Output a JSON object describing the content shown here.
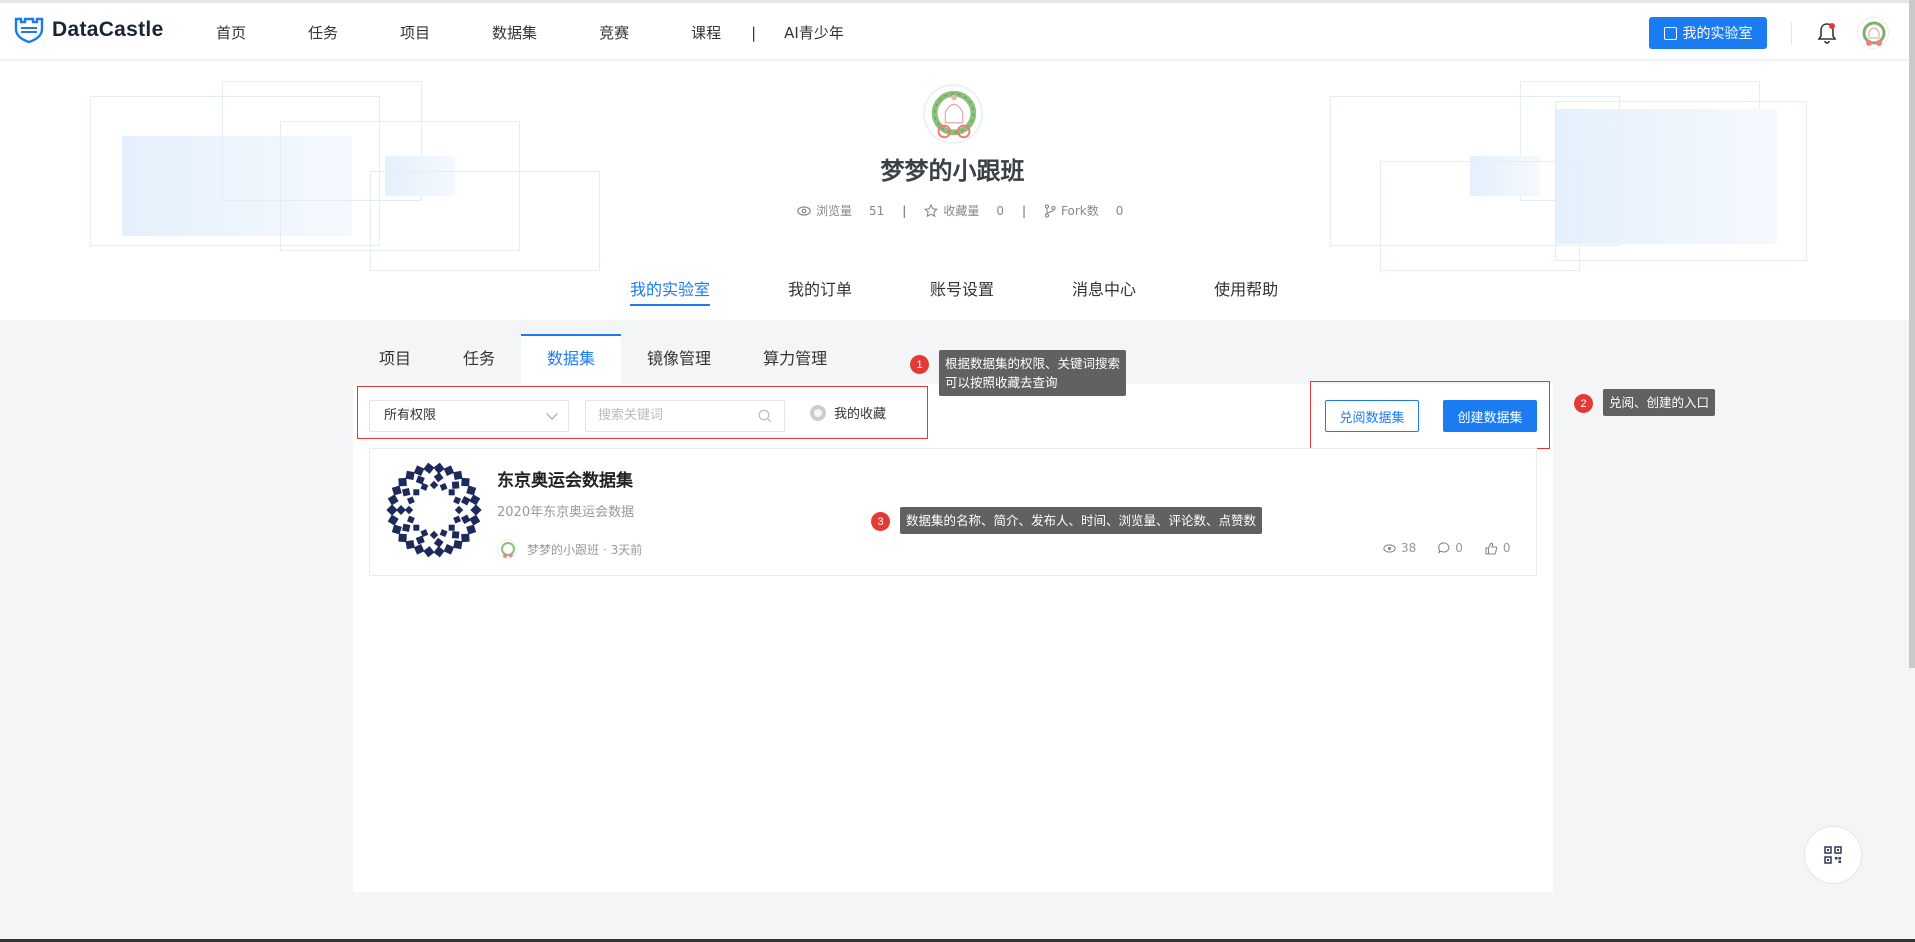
{
  "app": {
    "logo_text": "DataCastle"
  },
  "nav": {
    "items": [
      "首页",
      "任务",
      "项目",
      "数据集",
      "竞赛",
      "课程"
    ],
    "separator": "|",
    "extra": "AI青少年",
    "lab_button": "我的实验室"
  },
  "profile": {
    "name": "梦梦的小跟班",
    "stats": [
      {
        "label": "浏览量",
        "value": "51",
        "icon": "eye-icon"
      },
      {
        "label": "收藏量",
        "value": "0",
        "icon": "star-icon"
      },
      {
        "label": "Fork数",
        "value": "0",
        "icon": "fork-icon"
      }
    ],
    "stat_separator": "|"
  },
  "subnav": {
    "items": [
      "我的实验室",
      "我的订单",
      "账号设置",
      "消息中心",
      "使用帮助"
    ],
    "active": "我的实验室"
  },
  "tabs": {
    "items": [
      "项目",
      "任务",
      "数据集",
      "镜像管理",
      "算力管理"
    ],
    "active": "数据集"
  },
  "filters": {
    "permission_value": "所有权限",
    "search_placeholder": "搜索关键词",
    "favorites_label": "我的收藏"
  },
  "actions": {
    "redeem_label": "兑阅数据集",
    "create_label": "创建数据集"
  },
  "dataset_card": {
    "title": "东京奥运会数据集",
    "description": "2020年东京奥运会数据",
    "author": "梦梦的小跟班",
    "time": "· 3天前",
    "views": "38",
    "comments": "0",
    "likes": "0"
  },
  "annotations": [
    {
      "number": "1",
      "lines": [
        "根据数据集的权限、关键词搜索",
        "可以按照收藏去查询"
      ]
    },
    {
      "number": "2",
      "lines": [
        "兑阅、创建的入口"
      ]
    },
    {
      "number": "3",
      "lines": [
        "数据集的名称、简介、发布人、时间、浏览量、评论数、点赞数"
      ]
    }
  ],
  "colors": {
    "accent": "#1a7cf0",
    "annotation_red": "#e53935",
    "tooltip_bg": "#616161"
  }
}
